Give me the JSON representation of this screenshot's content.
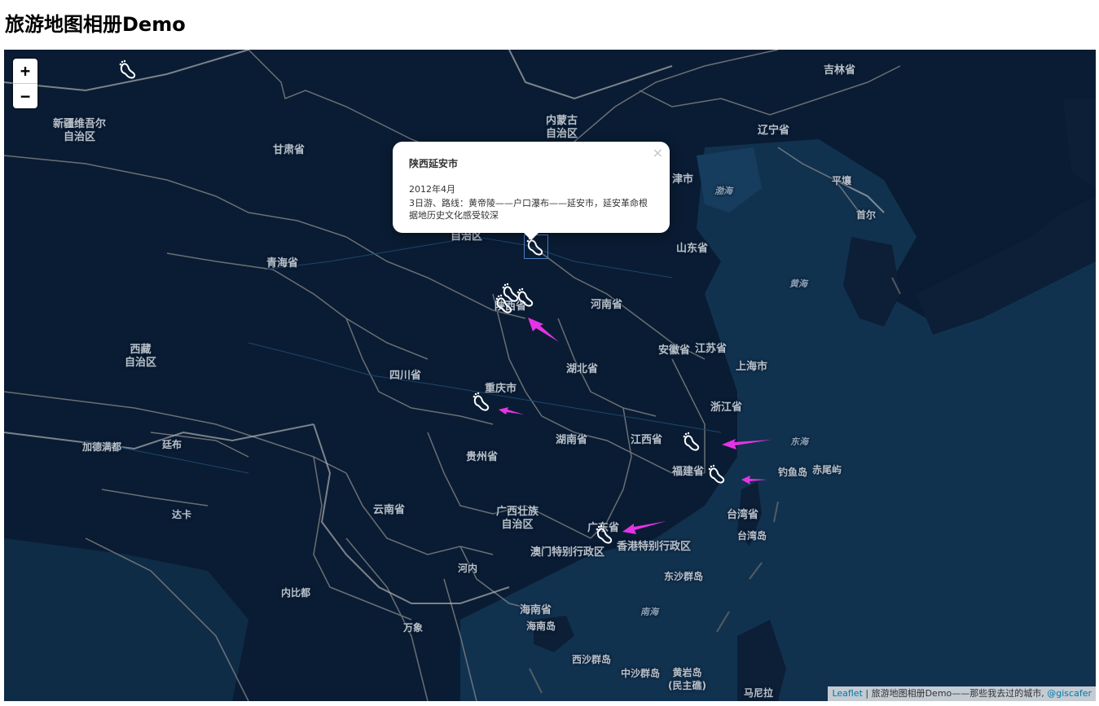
{
  "page": {
    "title": "旅游地图相册Demo"
  },
  "zoom": {
    "in_label": "+",
    "out_label": "−"
  },
  "labels": {
    "xinjiang": "新疆维吾尔\n自治区",
    "gansu": "甘肃省",
    "neimenggu": "内蒙古\n自治区",
    "liaoning": "辽宁省",
    "jilin": "吉林省",
    "qinghai": "青海省",
    "ningxia": "自治区",
    "shandong": "山东省",
    "tianjin": "津市",
    "bohai": "渤海",
    "pingrang": "平壤",
    "seoul": "首尔",
    "huanghai": "黄海",
    "shaanxi": "陕西省",
    "henan": "河南省",
    "anhui": "安徽省",
    "jiangsu": "江苏省",
    "shanghai": "上海市",
    "xizang": "西藏\n自治区",
    "sichuan": "四川省",
    "hubei": "湖北省",
    "chongqing": "重庆市",
    "zhejiang": "浙江省",
    "jiademan": "加德满都",
    "tingbu": "廷布",
    "guizhou": "贵州省",
    "hunan": "湖南省",
    "jiangxi": "江西省",
    "donghai": "东海",
    "fujian": "福建省",
    "diaoyu": "钓鱼岛",
    "chiwei": "赤尾屿",
    "daka": "达卡",
    "yunnan": "云南省",
    "guangxi": "广西壮族\n自治区",
    "guangdong": "广东省",
    "taiwan_prov": "台湾省",
    "taiwan_island": "台湾岛",
    "hongkong": "香港特别行政区",
    "macau": "澳门特别行政区",
    "hanoi": "河内",
    "dongsha": "东沙群岛",
    "naypyidaw": "内比都",
    "nanhai": "南海",
    "hainan": "海南省",
    "hainan_island": "海南岛",
    "wanxiang": "万象",
    "xisha": "西沙群岛",
    "zhongsha": "中沙群岛",
    "huangyan": "黄岩岛\n(民主礁)",
    "manila": "马尼拉"
  },
  "popup": {
    "title": "陕西延安市",
    "date": "2012年4月",
    "description": "3日游、路线：黄帝陵——户口瀑布——延安市，延安革命根据地历史文化感受较深",
    "close": "×"
  },
  "attribution": {
    "leaflet": "Leaflet",
    "text": " | 旅游地图相册Demo——那些我去过的城市, ",
    "author": "@giscafer"
  },
  "colors": {
    "map_bg": "#0a1c33",
    "sea": "#123553",
    "border": "#8b8b8b",
    "accent_arrow": "#e633e6"
  },
  "icons": {
    "marker": "footprint-icon",
    "arrow": "pink-arrow-icon"
  }
}
